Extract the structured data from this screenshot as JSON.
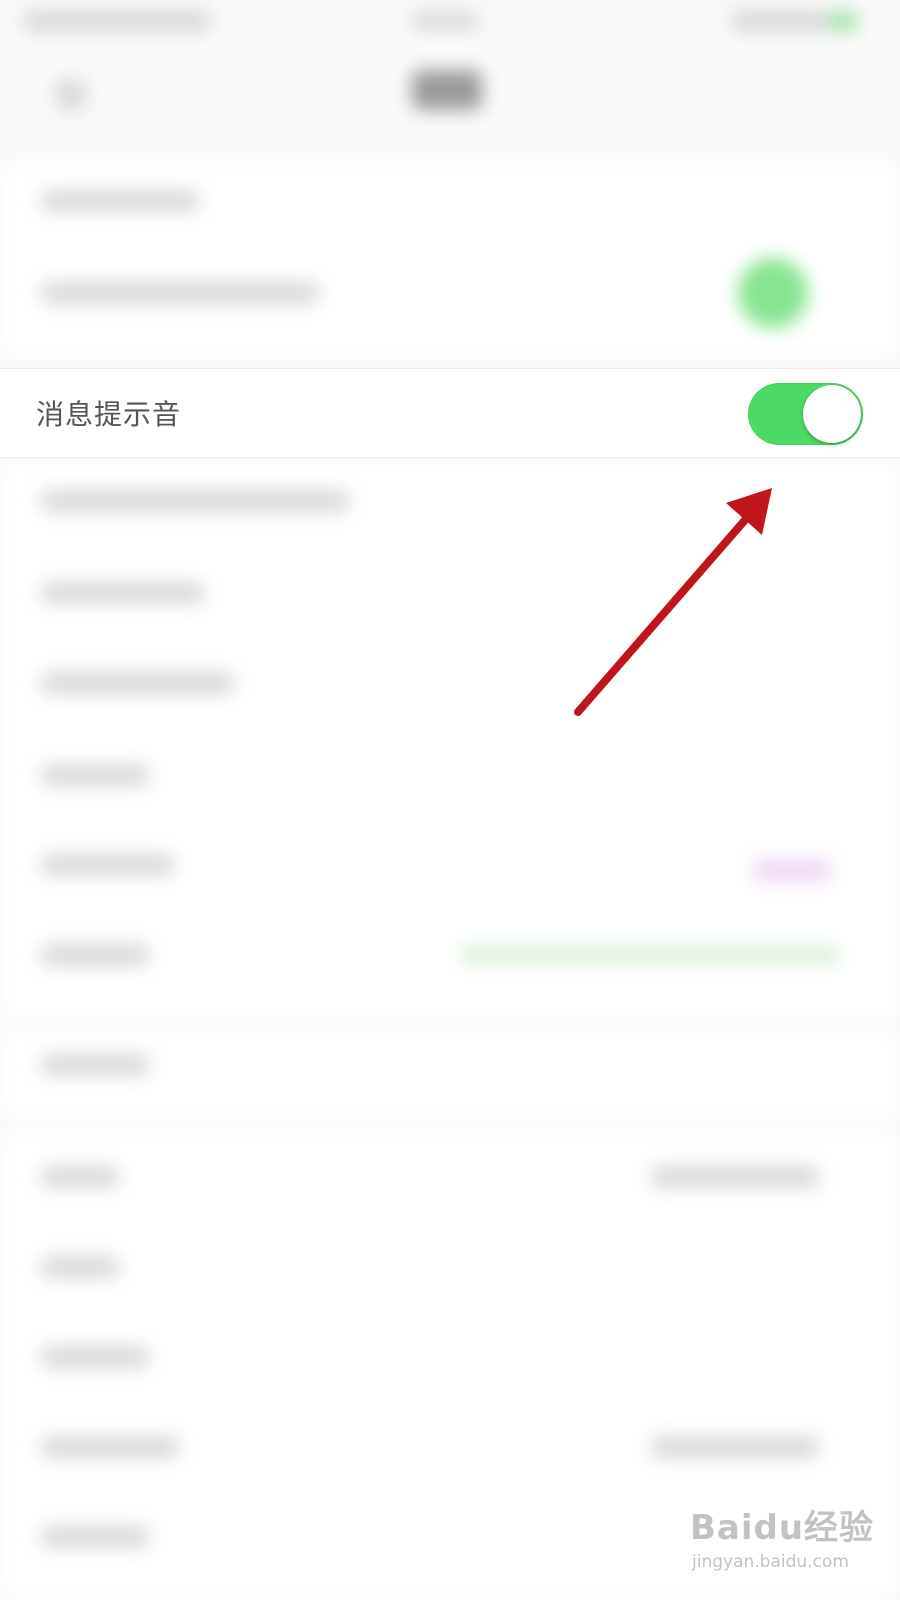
{
  "setting": {
    "label": "消息提示音",
    "toggle_on": true
  },
  "watermark": {
    "brand": "Baidu经验",
    "url": "jingyan.baidu.com"
  },
  "colors": {
    "toggle_on": "#4cd964",
    "arrow": "#c0151a",
    "background": "#f7f7f7"
  },
  "icons": {
    "arrow": "annotation-arrow-icon",
    "knob": "toggle-knob"
  }
}
